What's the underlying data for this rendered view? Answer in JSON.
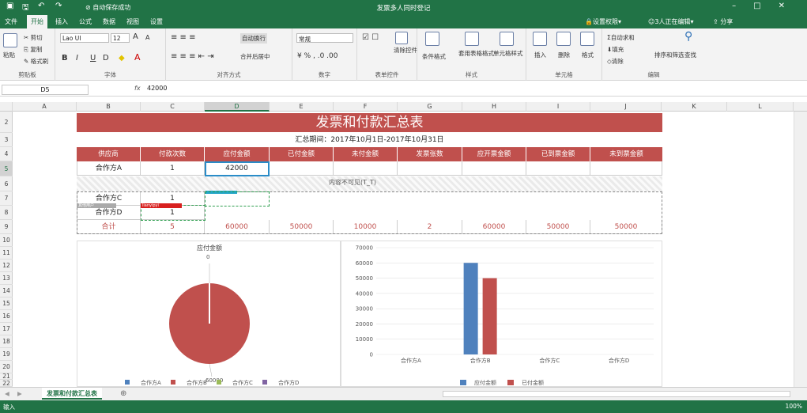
{
  "titlebar": {
    "title": "发票多人同时登记",
    "autosave": "自动保存成功",
    "share": "分享",
    "edit_status": "3人正在编辑",
    "permissions": "设置权限"
  },
  "tabs": [
    "文件",
    "开始",
    "插入",
    "公式",
    "数据",
    "视图",
    "设置"
  ],
  "ribbon": {
    "clipboard": {
      "paste": "粘贴",
      "cut": "剪切",
      "copy": "复制",
      "format_painter": "格式刷",
      "label": "剪贴板"
    },
    "font": {
      "name": "Lao UI",
      "size": "12",
      "label": "字体",
      "increase": "A",
      "decrease": "A",
      "bold": "B",
      "italic": "I",
      "underline": "U",
      "strike": "D"
    },
    "alignment": {
      "wrap": "自动换行",
      "merge": "合并后居中",
      "label": "对齐方式"
    },
    "number": {
      "format": "常规",
      "label": "数字"
    },
    "form_controls": {
      "label": "表单控件",
      "clear": "清除控件"
    },
    "styles": {
      "conditional": "条件格式",
      "table_format": "套用表格格式",
      "cell_style": "单元格样式",
      "label": "样式"
    },
    "cells": {
      "insert": "插入",
      "delete": "删除",
      "format": "格式",
      "label": "单元格"
    },
    "editing": {
      "autosum": "自动求和",
      "fill": "填充",
      "clear": "清除",
      "sort_filter": "排序和筛选",
      "find": "查找",
      "label": "编辑"
    }
  },
  "formula_bar": {
    "cell_ref": "D5",
    "fx": "fx",
    "value": "42000"
  },
  "columns": [
    "A",
    "B",
    "C",
    "D",
    "E",
    "F",
    "G",
    "H",
    "I",
    "J",
    "K",
    "L"
  ],
  "rows": [
    "2",
    "3",
    "4",
    "5",
    "6",
    "7",
    "8",
    "9",
    "10",
    "11",
    "12",
    "13",
    "14",
    "15",
    "16",
    "17",
    "18",
    "19",
    "20",
    "21",
    "22"
  ],
  "report": {
    "title": "发票和付款汇总表",
    "period": "汇总期间：2017年10月1日-2017年10月31日",
    "headers": [
      "供应商",
      "付款次数",
      "应付金额",
      "已付金额",
      "未付金额",
      "发票张数",
      "应开票金额",
      "已到票金额",
      "未到票金额"
    ],
    "row5": {
      "supplier": "合作方A",
      "count": "1",
      "payable": "42000"
    },
    "hidden_message": "内容不可见(T_T)",
    "row7": {
      "supplier": "合作方C",
      "count": "1"
    },
    "row8": {
      "supplier": "合作方D",
      "count": "1"
    },
    "total": {
      "label": "合计",
      "count": "5",
      "payable": "60000",
      "paid": "50000",
      "unpaid": "10000",
      "invoices": "2",
      "to_invoice": "60000",
      "received": "50000",
      "pending": "50000"
    },
    "editor_tags": {
      "red": "lianyipyi",
      "grey": "其他用户"
    }
  },
  "chart_data": [
    {
      "type": "pie",
      "title": "应付金额",
      "slices": [
        {
          "label": "合作方A",
          "value": 0
        },
        {
          "label": "合作方B",
          "value": 60000
        },
        {
          "label": "合作方C",
          "value": 0
        },
        {
          "label": "合作方D",
          "value": 0
        }
      ],
      "data_labels": [
        "0",
        "60000"
      ],
      "colors": [
        "#4f81bd",
        "#c0504d",
        "#9bbb59",
        "#8064a2"
      ],
      "legend": "bottom"
    },
    {
      "type": "bar",
      "categories": [
        "合作方A",
        "合作方B",
        "合作方C",
        "合作方D"
      ],
      "series": [
        {
          "name": "应付金额",
          "values": [
            0,
            60000,
            0,
            0
          ],
          "color": "#4f81bd"
        },
        {
          "name": "已付金额",
          "values": [
            0,
            50000,
            0,
            0
          ],
          "color": "#c0504d"
        }
      ],
      "ylim": [
        0,
        70000
      ],
      "yticks": [
        "0",
        "10000",
        "20000",
        "30000",
        "40000",
        "50000",
        "60000",
        "70000"
      ],
      "grid": true,
      "legend": "bottom"
    }
  ],
  "sheet_tab": "发票和付款汇总表",
  "status": {
    "mode": "输入",
    "zoom": "100%"
  }
}
